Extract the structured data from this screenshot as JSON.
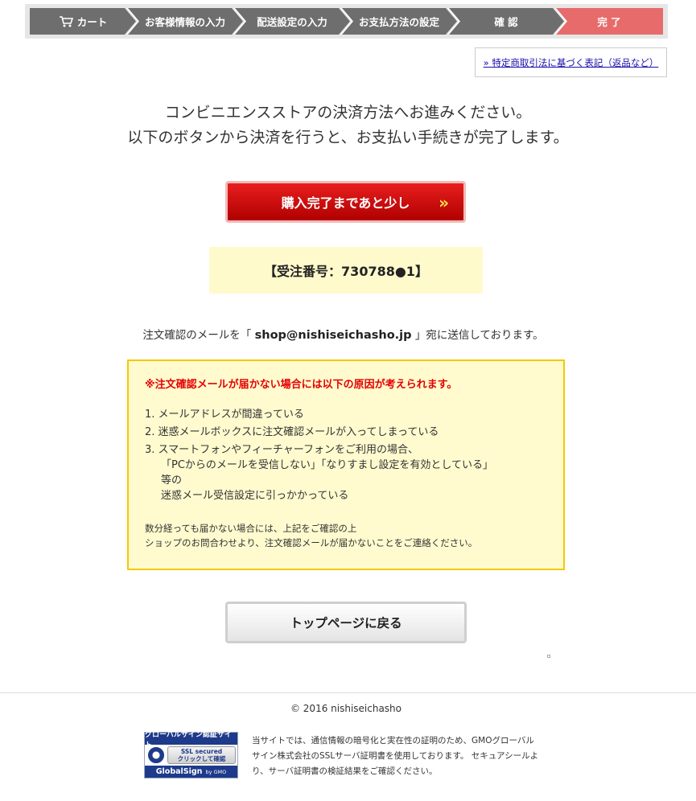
{
  "steps": [
    {
      "label": "カート",
      "icon": "cart-icon",
      "state": "done"
    },
    {
      "label": "お客様情報の入力",
      "state": "done"
    },
    {
      "label": "配送設定の入力",
      "state": "done"
    },
    {
      "label": "お支払方法の設定",
      "state": "done"
    },
    {
      "label": "確 認",
      "state": "done"
    },
    {
      "label": "完 了",
      "state": "current"
    }
  ],
  "colors": {
    "step_done": "#6e6e6e",
    "step_current": "#e86b6b",
    "accent_red": "#cc0000",
    "notice_bg": "#fffbcf"
  },
  "legal_link": "» 特定商取引法に基づく表記（返品など）",
  "intro": {
    "line1": "コンビニエンスストアの決済方法へお進みください。",
    "line2": "以下のボタンから決済を行うと、お支払い手続きが完了します。"
  },
  "pay_button": {
    "label": "購入完了まであと少し",
    "chevron": "»"
  },
  "order_number": "【受注番号：730788●1】",
  "mail_confirm": {
    "prefix": "注文確認のメールを「",
    "email": "shop@nishiseichasho.jp",
    "suffix": "」宛に送信しております。"
  },
  "notice": {
    "warning": "※注文確認メールが届かない場合には以下の原因が考えられます。",
    "reasons": [
      "1. メールアドレスが間違っている",
      "2. 迷惑メールボックスに注文確認メールが入ってしまっている",
      "3. スマートフォンやフィーチャーフォンをご利用の場合、"
    ],
    "reason3_detail1": "「PCからのメールを受信しない」「なりすまし設定を有効としている」等の",
    "reason3_detail2": "迷惑メール受信設定に引っかかっている",
    "footer1": "数分経っても届かない場合には、上記をご確認の上",
    "footer2": "ショップのお問合わせより、注文確認メールが届かないことをご連絡ください。"
  },
  "top_button": {
    "label": "トップページに戻る"
  },
  "copyright": "© 2016 nishiseichasho",
  "globalsign": {
    "badge_top": "グローバルサイン認証サイト",
    "badge_ssl1": "SSL secured",
    "badge_ssl2": "クリックして確認",
    "badge_brand": "GlobalSign",
    "badge_by": "by GMO",
    "text": "当サイトでは、通信情報の暗号化と実在性の証明のため、GMOグローバルサイン株式会社のSSLサーバ証明書を使用しております。 セキュアシールより、サーバ証明書の検証結果をご確認ください。"
  }
}
